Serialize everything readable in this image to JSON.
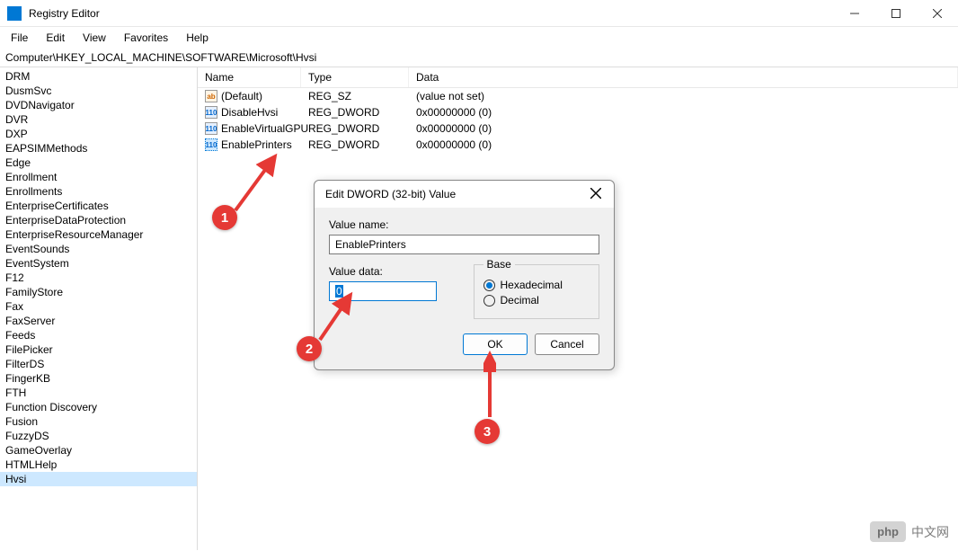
{
  "window": {
    "title": "Registry Editor",
    "min": "–",
    "max": "□",
    "close": "✕"
  },
  "menu": {
    "file": "File",
    "edit": "Edit",
    "view": "View",
    "favorites": "Favorites",
    "help": "Help"
  },
  "address": "Computer\\HKEY_LOCAL_MACHINE\\SOFTWARE\\Microsoft\\Hvsi",
  "tree": {
    "items": [
      "DRM",
      "DusmSvc",
      "DVDNavigator",
      "DVR",
      "DXP",
      "EAPSIMMethods",
      "Edge",
      "Enrollment",
      "Enrollments",
      "EnterpriseCertificates",
      "EnterpriseDataProtection",
      "EnterpriseResourceManager",
      "EventSounds",
      "EventSystem",
      "F12",
      "FamilyStore",
      "Fax",
      "FaxServer",
      "Feeds",
      "FilePicker",
      "FilterDS",
      "FingerKB",
      "FTH",
      "Function Discovery",
      "Fusion",
      "FuzzyDS",
      "GameOverlay",
      "HTMLHelp",
      "Hvsi"
    ],
    "selected": "Hvsi"
  },
  "list": {
    "headers": {
      "name": "Name",
      "type": "Type",
      "data": "Data"
    },
    "rows": [
      {
        "icon": "sz",
        "name": "(Default)",
        "type": "REG_SZ",
        "data": "(value not set)"
      },
      {
        "icon": "dw",
        "name": "DisableHvsi",
        "type": "REG_DWORD",
        "data": "0x00000000 (0)"
      },
      {
        "icon": "dw",
        "name": "EnableVirtualGPU",
        "type": "REG_DWORD",
        "data": "0x00000000 (0)"
      },
      {
        "icon": "dw",
        "name": "EnablePrinters",
        "type": "REG_DWORD",
        "data": "0x00000000 (0)",
        "selected": true
      }
    ]
  },
  "dialog": {
    "title": "Edit DWORD (32-bit) Value",
    "value_name_label": "Value name:",
    "value_name": "EnablePrinters",
    "value_data_label": "Value data:",
    "value_data": "0",
    "base_label": "Base",
    "hex": "Hexadecimal",
    "dec": "Decimal",
    "ok": "OK",
    "cancel": "Cancel"
  },
  "annotations": {
    "a1": "1",
    "a2": "2",
    "a3": "3"
  },
  "watermark": {
    "logo": "php",
    "text": "中文网"
  }
}
